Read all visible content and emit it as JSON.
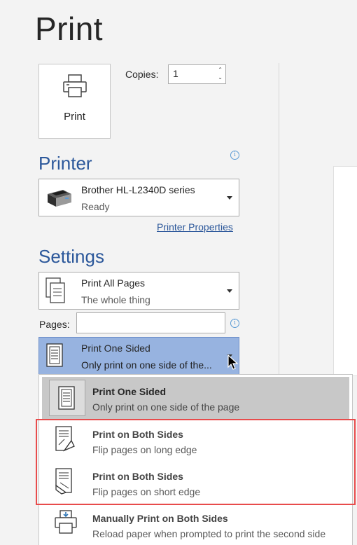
{
  "title": "Print",
  "print_button": {
    "label": "Print",
    "icon": "printer-icon"
  },
  "copies": {
    "label": "Copies:",
    "value": "1"
  },
  "printer": {
    "heading": "Printer",
    "name": "Brother HL-L2340D series",
    "status": "Ready",
    "properties_link": "Printer Properties"
  },
  "settings": {
    "heading": "Settings",
    "pages_range": {
      "title": "Print All Pages",
      "subtitle": "The whole thing"
    },
    "pages_label": "Pages:",
    "pages_value": "",
    "sides": {
      "title": "Print One Sided",
      "subtitle": "Only print on one side of the..."
    }
  },
  "menu": {
    "items": [
      {
        "title": "Print One Sided",
        "subtitle": "Only print on one side of the page"
      },
      {
        "title": "Print on Both Sides",
        "subtitle": "Flip pages on long edge"
      },
      {
        "title": "Print on Both Sides",
        "subtitle": "Flip pages on short edge"
      },
      {
        "title": "Manually Print on Both Sides",
        "subtitle": "Reload paper when prompted to print the second side"
      }
    ]
  },
  "colors": {
    "accent": "#2b579a",
    "selected_dropdown": "#97b3e0",
    "highlight_border": "#e84c4c",
    "background": "#f3f3f3"
  }
}
